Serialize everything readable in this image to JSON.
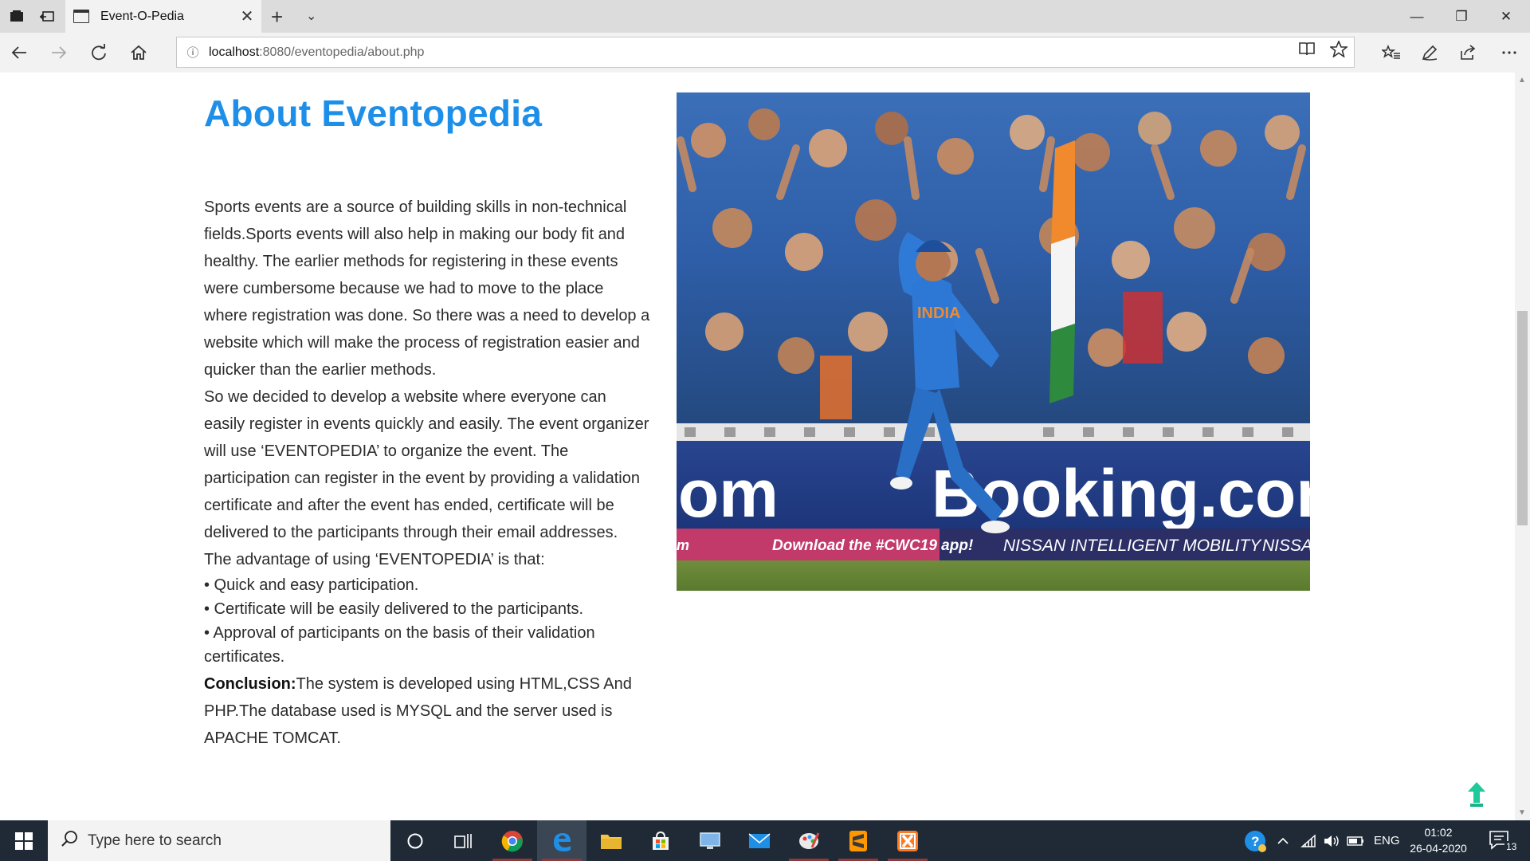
{
  "browser": {
    "tab_title": "Event-O-Pedia",
    "close_glyph": "✕",
    "new_tab_glyph": "+",
    "tab_list_glyph": "⌄",
    "url_host": "localhost",
    "url_rest": ":8080/eventopedia/about.php",
    "window_controls": {
      "minimize": "—",
      "restore": "❐",
      "close": "✕"
    }
  },
  "page": {
    "title": "About Eventopedia",
    "paragraph1": "Sports events are a source of building skills in non-technical fields.Sports events will also help in making our body fit and healthy. The earlier methods for registering in these events were cumbersome because we had to move to the place where registration was done. So there was a need to develop a website which will make the process of registration easier and quicker than the earlier methods.",
    "paragraph2": "So we decided to develop a website where everyone can easily register in events quickly and easily. The event organizer will use ‘EVENTOPEDIA’ to organize the event. The participation can register in the event by providing a validation certificate and after the event has ended, certificate will be delivered to the participants through their email addresses.",
    "advantage_intro": "The advantage of using ‘EVENTOPEDIA’ is that:",
    "advantages": [
      "• Quick and easy participation.",
      "• Certificate will be easily delivered to the participants.",
      "• Approval of participants on the basis of their validation certificates."
    ],
    "conclusion_label": "Conclusion:",
    "conclusion_text": "The system is developed using HTML,CSS And PHP.The database used is MYSQL and the server used is APACHE TOMCAT.",
    "hero_image": {
      "jersey_text": "INDIA",
      "board_text_left": "om",
      "board_text_right": "Booking.com",
      "strip_left": "Download the #CWC19 app!",
      "strip_right": "NISSAN INTELLIGENT MOBILITY",
      "strip_far_right": "NISSA",
      "strip_far_left": "m"
    }
  },
  "taskbar": {
    "search_placeholder": "Type here to search",
    "language": "ENG",
    "time": "01:02",
    "date": "26-04-2020",
    "notification_count": "13"
  },
  "colors": {
    "title_blue": "#1e8fe8",
    "taskbar_bg": "#1f2a36",
    "scroll_top_green": "#1ec99a"
  }
}
